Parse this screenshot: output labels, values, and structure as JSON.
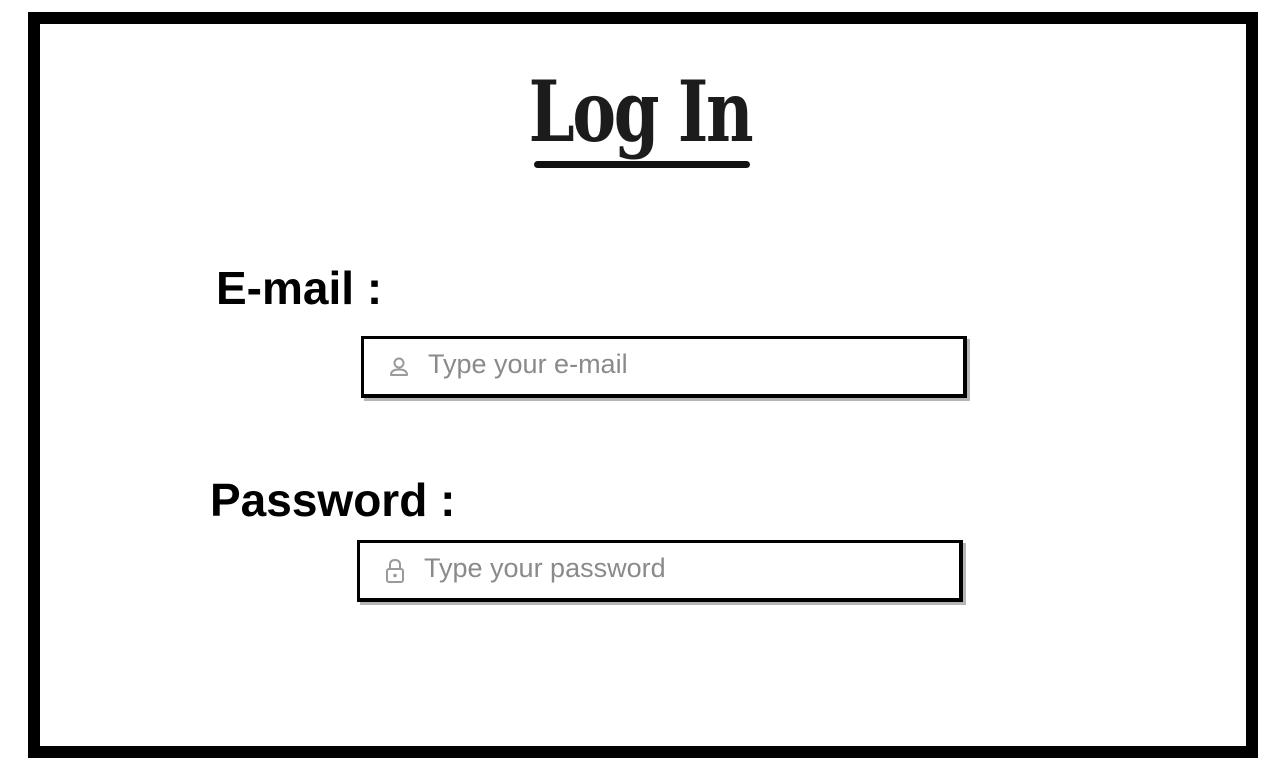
{
  "page": {
    "title": "Log In"
  },
  "email": {
    "label": "E-mail :",
    "placeholder": "Type your e-mail",
    "value": "",
    "icon": "user-icon"
  },
  "password": {
    "label": "Password :",
    "placeholder": "Type your password",
    "value": "",
    "icon": "lock-icon"
  },
  "colors": {
    "border": "#000000",
    "background": "#ffffff",
    "placeholder": "#8a8a8a",
    "icon": "#9a9a9a"
  }
}
